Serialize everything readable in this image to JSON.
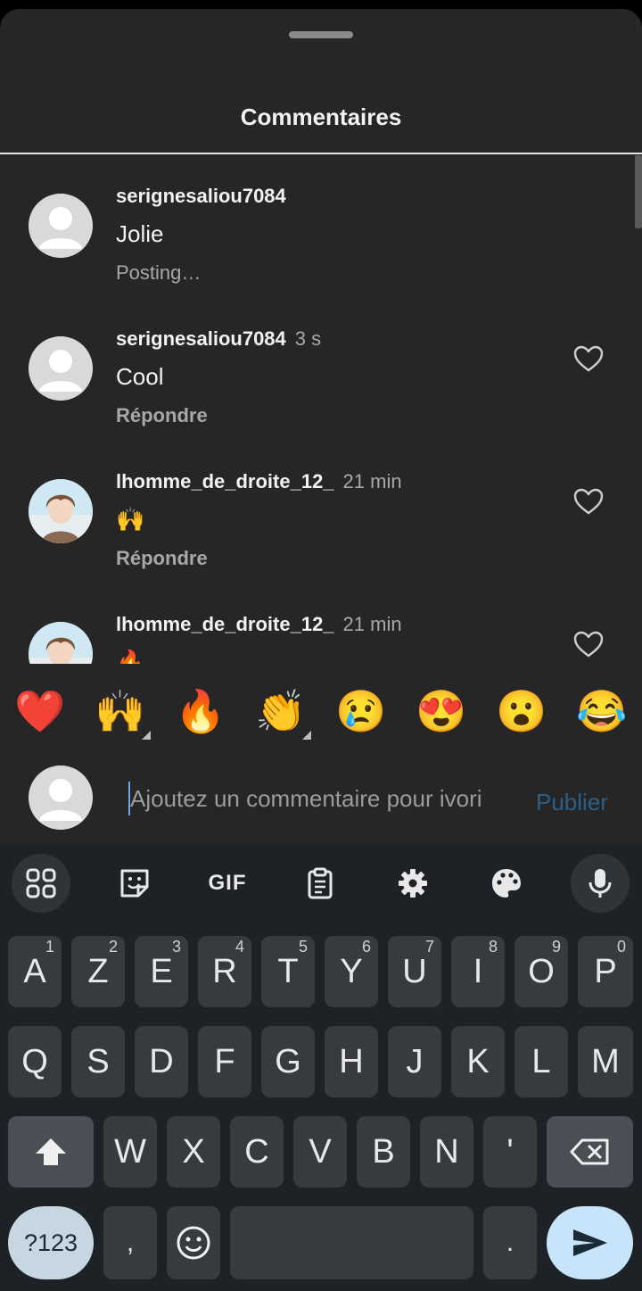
{
  "sheet": {
    "title": "Commentaires"
  },
  "comments": [
    {
      "username": "serignesaliou7084",
      "time": "",
      "text": "Jolie",
      "status": "Posting…",
      "avatar": "default-avatar-icon"
    },
    {
      "username": "serignesaliou7084",
      "time": "3 s",
      "text": "Cool",
      "reply": "Répondre",
      "avatar": "default-avatar-icon"
    },
    {
      "username": "lhomme_de_droite_12_",
      "time": "21 min",
      "text": "🙌",
      "reply": "Répondre",
      "avatar": "anime-avatar"
    },
    {
      "username": "lhomme_de_droite_12_",
      "time": "21 min",
      "text": "🔥",
      "avatar": "anime-avatar"
    }
  ],
  "emoji_bar": [
    "❤️",
    "🙌",
    "🔥",
    "👏",
    "😢",
    "😍",
    "😮",
    "😂"
  ],
  "composer": {
    "placeholder": "Ajoutez un commentaire pour ivori",
    "publish": "Publier"
  },
  "keyboard": {
    "toolbar": [
      "apps-icon",
      "sticker-icon",
      "gif-icon",
      "clipboard-icon",
      "settings-icon",
      "palette-icon",
      "mic-icon"
    ],
    "gif_label": "GIF",
    "row1": [
      {
        "k": "A",
        "n": "1"
      },
      {
        "k": "Z",
        "n": "2"
      },
      {
        "k": "E",
        "n": "3"
      },
      {
        "k": "R",
        "n": "4"
      },
      {
        "k": "T",
        "n": "5"
      },
      {
        "k": "Y",
        "n": "6"
      },
      {
        "k": "U",
        "n": "7"
      },
      {
        "k": "I",
        "n": "8"
      },
      {
        "k": "O",
        "n": "9"
      },
      {
        "k": "P",
        "n": "0"
      }
    ],
    "row2": [
      "Q",
      "S",
      "D",
      "F",
      "G",
      "H",
      "J",
      "K",
      "L",
      "M"
    ],
    "row3": [
      "W",
      "X",
      "C",
      "V",
      "B",
      "N",
      "'"
    ],
    "symbols": "?123",
    "comma": ",",
    "period": "."
  },
  "colors": {
    "sheet_bg": "#262626",
    "keyboard_bg": "#1e2226",
    "key_bg": "#373b40",
    "publish": "#2d5f86",
    "enter_key": "#c7e4fb"
  }
}
